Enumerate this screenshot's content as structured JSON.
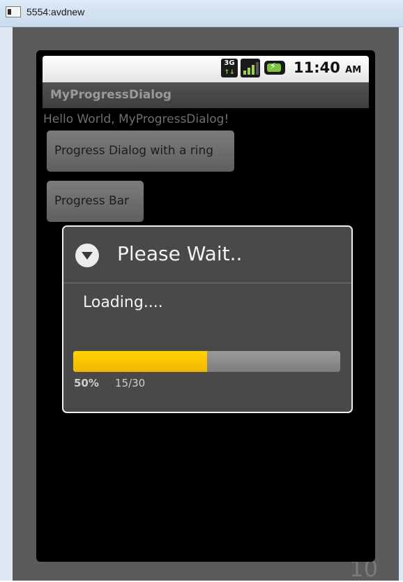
{
  "window": {
    "title": "5554:avdnew"
  },
  "emulator": {
    "keypad_number": "10"
  },
  "status_bar": {
    "network": "3G",
    "network_arrows": "↑↓",
    "time": "11:40",
    "ampm": "AM"
  },
  "app": {
    "title": "MyProgressDialog",
    "hello_text": "Hello World, MyProgressDialog!",
    "button_ring_label": "Progress Dialog with a ring",
    "button_bar_label": "Progress Bar"
  },
  "dialog": {
    "title": "Please Wait..",
    "message": "Loading....",
    "progress_fraction": 0.5,
    "percent_label": "50%",
    "count_label": "15/30"
  },
  "colors": {
    "progress_fill": "#ffcc00",
    "screen_background": "#000000",
    "dialog_background": "#494949"
  },
  "icons": {
    "dialog_icon": "alert-dropdown-icon",
    "window_icon": "emulator-window-icon"
  }
}
